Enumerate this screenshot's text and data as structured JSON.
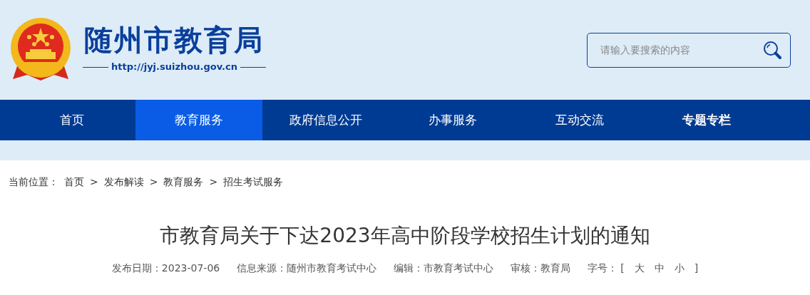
{
  "site": {
    "title": "随州市教育局",
    "url": "http://jyj.suizhou.gov.cn"
  },
  "search": {
    "placeholder": "请输入要搜索的内容"
  },
  "nav": [
    {
      "label": "首页",
      "selected": false,
      "bold": false
    },
    {
      "label": "教育服务",
      "selected": true,
      "bold": false
    },
    {
      "label": "政府信息公开",
      "selected": false,
      "bold": false
    },
    {
      "label": "办事服务",
      "selected": false,
      "bold": false
    },
    {
      "label": "互动交流",
      "selected": false,
      "bold": false
    },
    {
      "label": "专题专栏",
      "selected": false,
      "bold": true
    }
  ],
  "breadcrumb": {
    "label": "当前位置：",
    "items": [
      "首页",
      "发布解读",
      "教育服务",
      "招生考试服务"
    ],
    "separator": ">"
  },
  "article": {
    "title": "市教育局关于下达2023年高中阶段学校招生计划的通知",
    "meta": [
      "发布日期：2023-07-06",
      "信息来源：随州市教育考试中心",
      "编辑：市教育考试中心",
      "审核：教育局"
    ],
    "font_size": {
      "label": "字号：",
      "open": "[",
      "options": [
        "大",
        "中",
        "小"
      ],
      "close": "]"
    }
  }
}
